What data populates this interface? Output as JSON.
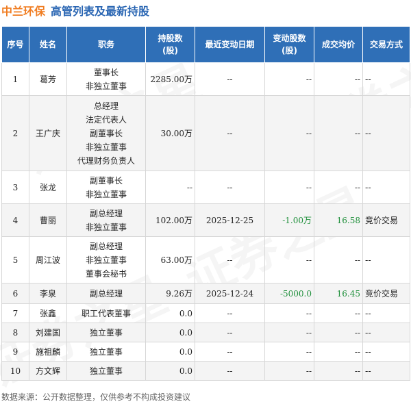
{
  "header": {
    "company": "中兰环保",
    "subtitle": "高管列表及最新持股"
  },
  "table": {
    "columns": [
      "序号",
      "姓名",
      "职务",
      "持股数\n(股)",
      "最近变动日期",
      "变动股数\n(股)",
      "成交均价",
      "交易方式"
    ],
    "rows": [
      {
        "no": "1",
        "name": "葛芳",
        "positions": [
          "董事长",
          "非独立董事"
        ],
        "shares": "2285.00万",
        "date": "--",
        "change": "--",
        "price": "--",
        "method": "--"
      },
      {
        "no": "2",
        "name": "王广庆",
        "positions": [
          "总经理",
          "法定代表人",
          "副董事长",
          "非独立董事",
          "代理财务负责人"
        ],
        "shares": "30.00万",
        "date": "--",
        "change": "--",
        "price": "--",
        "method": "--"
      },
      {
        "no": "3",
        "name": "张龙",
        "positions": [
          "副董事长",
          "非独立董事"
        ],
        "shares": "--",
        "date": "--",
        "change": "--",
        "price": "--",
        "method": "--"
      },
      {
        "no": "4",
        "name": "曹丽",
        "positions": [
          "副总经理",
          "非独立董事"
        ],
        "shares": "102.00万",
        "date": "2025-12-25",
        "change": "-1.00万",
        "price": "16.58",
        "method": "竞价交易"
      },
      {
        "no": "5",
        "name": "周江波",
        "positions": [
          "副总经理",
          "非独立董事",
          "董事会秘书"
        ],
        "shares": "63.00万",
        "date": "--",
        "change": "--",
        "price": "--",
        "method": "--"
      },
      {
        "no": "6",
        "name": "李泉",
        "positions": [
          "副总经理"
        ],
        "shares": "9.26万",
        "date": "2025-12-24",
        "change": "-5000.0",
        "price": "16.45",
        "method": "竞价交易"
      },
      {
        "no": "7",
        "name": "张鑫",
        "positions": [
          "职工代表董事"
        ],
        "shares": "0.0",
        "date": "--",
        "change": "--",
        "price": "--",
        "method": "--"
      },
      {
        "no": "8",
        "name": "刘建国",
        "positions": [
          "独立董事"
        ],
        "shares": "0.0",
        "date": "--",
        "change": "--",
        "price": "--",
        "method": "--"
      },
      {
        "no": "9",
        "name": "施祖麟",
        "positions": [
          "独立董事"
        ],
        "shares": "0.0",
        "date": "--",
        "change": "--",
        "price": "--",
        "method": "--"
      },
      {
        "no": "10",
        "name": "方文辉",
        "positions": [
          "独立董事"
        ],
        "shares": "0.0",
        "date": "--",
        "change": "--",
        "price": "--",
        "method": "--"
      }
    ]
  },
  "footer": {
    "source": "数据来源：公开数据整理，仅供参考不构成投资建议"
  },
  "colors": {
    "accent": "#2f6fb7",
    "brand": "#f07d22",
    "positive_change": "#1e8f3a"
  }
}
